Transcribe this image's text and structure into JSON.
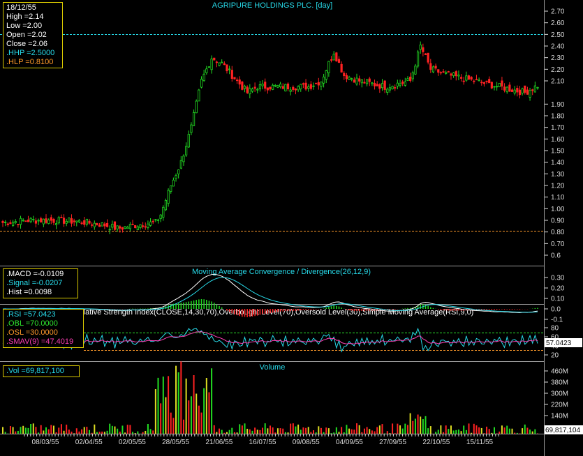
{
  "title": "AGRIPURE HOLDINGS PLC. [day]",
  "colors": {
    "background": "#000000",
    "up": "#22dd22",
    "down": "#ff2222",
    "axis": "#dddddd",
    "hhp": "#27d9e8",
    "hlp": "#ff9a2a",
    "panel_border": "#9a9a9a",
    "box_border": "#d8c800"
  },
  "info": {
    "date": "18/12/55",
    "high": "High  =2.14",
    "low": "Low  =2.00",
    "open": "Open  =2.02",
    "close": "Close  =2.06",
    "hhp": ".HHP  =2.5000",
    "hlp": ".HLP  =0.8100"
  },
  "macd": {
    "title": "Moving Average Convergence / Divergence(26,12,9)",
    "macd": ".MACD  =-0.0109",
    "signal": ".Signal  =-0.0207",
    "hist": ".Hist  =0.0098"
  },
  "rsi": {
    "title": "Relative Strength Index(CLOSE,14,30,70),Overbought Level(70),Oversold Level(30),Simple Moving Average(RSI,9,0)",
    "rsi": ".RSI  =57.0423",
    "obl": ".OBL  =70.0000",
    "osl": ".OSL  =30.0000",
    "smav": ".SMAV(9)  =47.4019",
    "last": "57.0423"
  },
  "volume": {
    "title": "Volume",
    "vol": ".Vol  =69,817,100",
    "last": "69,817,104"
  },
  "price_axis": [
    "2.70",
    "2.60",
    "2.50",
    "2.40",
    "2.30",
    "2.20",
    "2.10",
    "1.90",
    "1.80",
    "1.70",
    "1.60",
    "1.50",
    "1.40",
    "1.30",
    "1.20",
    "1.10",
    "1.00",
    "0.90",
    "0.80",
    "0.70",
    "0.6"
  ],
  "macd_axis": [
    "0.30",
    "0.20",
    "0.10",
    "0.0",
    "-0.1"
  ],
  "rsi_axis": [
    "80",
    "60",
    "40",
    "20"
  ],
  "vol_axis": [
    "460M",
    "380M",
    "300M",
    "220M",
    "140M"
  ],
  "date_axis": [
    "08/03/55",
    "02/04/55",
    "02/05/55",
    "28/05/55",
    "21/06/55",
    "16/07/55",
    "09/08/55",
    "04/09/55",
    "27/09/55",
    "22/10/55",
    "15/11/55"
  ],
  "chart_data": {
    "type": "line",
    "title": "AGRIPURE HOLDINGS PLC. [day]",
    "series": [
      {
        "values_description_only": false,
        "anchors": [
          [
            0,
            0.88
          ],
          [
            10,
            0.9
          ],
          [
            20,
            0.9
          ],
          [
            30,
            0.89
          ],
          [
            40,
            0.86
          ],
          [
            45,
            0.83
          ],
          [
            55,
            0.87
          ],
          [
            60,
            0.88
          ],
          [
            62,
            0.95
          ],
          [
            66,
            1.2
          ],
          [
            70,
            1.4
          ],
          [
            74,
            1.7
          ],
          [
            78,
            2.1
          ],
          [
            82,
            2.3
          ],
          [
            86,
            2.25
          ],
          [
            90,
            2.15
          ],
          [
            96,
            2.0
          ],
          [
            100,
            2.05
          ],
          [
            110,
            2.05
          ],
          [
            120,
            2.05
          ],
          [
            125,
            2.1
          ],
          [
            130,
            2.35
          ],
          [
            134,
            2.15
          ],
          [
            140,
            2.1
          ],
          [
            150,
            2.05
          ],
          [
            160,
            2.1
          ],
          [
            164,
            2.4
          ],
          [
            168,
            2.2
          ],
          [
            175,
            2.15
          ],
          [
            185,
            2.1
          ],
          [
            195,
            2.05
          ],
          [
            205,
            2.0
          ],
          [
            210,
            2.06
          ]
        ]
      }
    ],
    "hhp": 2.5,
    "hlp": 0.81,
    "ylim": [
      0.55,
      2.75
    ]
  }
}
